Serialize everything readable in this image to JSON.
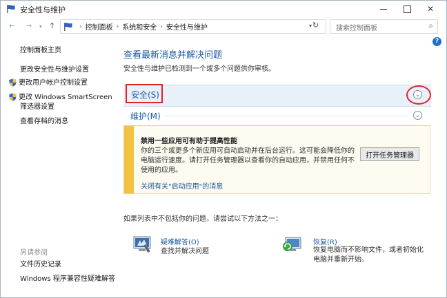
{
  "window": {
    "title": "安全性与维护"
  },
  "address": {
    "crumbs": [
      "控制面板",
      "系统和安全",
      "安全性与维护"
    ],
    "search_placeholder": "搜索控制面板"
  },
  "left": {
    "home": "控制面板主页",
    "links": [
      {
        "label": "更改安全性与维护设置",
        "shield": false
      },
      {
        "label": "更改用户帐户控制设置",
        "shield": true
      },
      {
        "label": "更改 Windows SmartScreen",
        "label2": "筛选器设置",
        "shield": true
      },
      {
        "label": "查看存档的消息",
        "shield": false
      }
    ],
    "see_also": "另请参阅",
    "see_also_links": [
      "文件历史记录",
      "Windows 程序兼容性疑难解答"
    ]
  },
  "main": {
    "title": "查看最新消息并解决问题",
    "subtitle": "安全性与维护已检测到一个或多个问题供你审核。",
    "security_label": "安全(S)",
    "maintenance_label": "维护(M)",
    "card": {
      "title": "禁用一些应用可有助于提高性能",
      "body": "你的三个或更多个新应用可自动启动并在后台运行。这可能会降低你的电脑运行速度。请打开任务管理器以查看你的自动应用，并禁用任何不使用的应用。",
      "link": "关闭有关\"启动应用\"的消息",
      "button": "打开任务管理器"
    },
    "try_text": "如果列表中不包括你的问题，请尝试以下方法之一：",
    "troubleshoot": {
      "title": "疑难解答(O)",
      "desc": "查找并解决问题"
    },
    "recovery": {
      "title": "恢复(R)",
      "desc": "恢复电脑而不影响文件，或者初始化电脑并重新开始。"
    }
  },
  "colors": {
    "accent": "#1a5aa3",
    "highlight_red": "#e0232b",
    "warning": "#f4c242"
  },
  "icons": [
    "flag-icon",
    "back-arrow-icon",
    "forward-arrow-icon",
    "up-arrow-icon",
    "refresh-icon",
    "search-icon",
    "help-icon",
    "shield-icon",
    "chevron-down-icon",
    "troubleshoot-icon",
    "recovery-icon"
  ]
}
